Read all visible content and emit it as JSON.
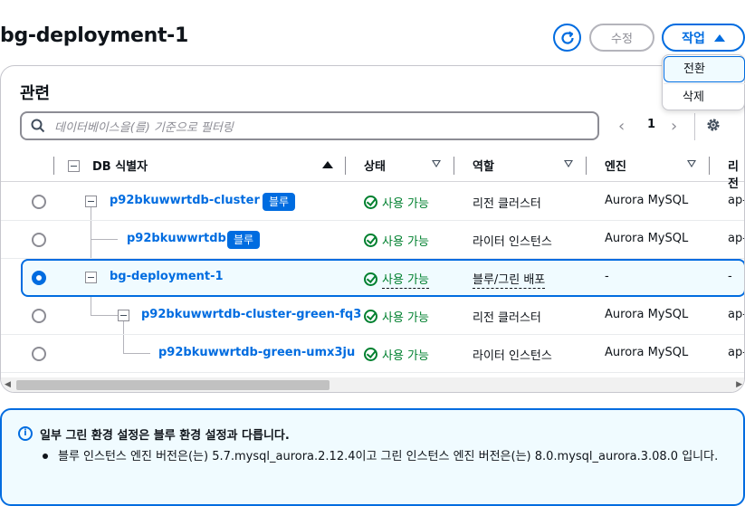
{
  "page": {
    "title": "bg-deployment-1"
  },
  "header_buttons": {
    "refresh_icon": "refresh-icon",
    "edit_label": "수정",
    "action_label": "작업"
  },
  "action_menu": {
    "items": [
      "전환",
      "삭제"
    ]
  },
  "related": {
    "title": "관련",
    "filter_placeholder": "데이터베이스을(를) 기준으로 필터링",
    "page_number": "1",
    "columns": [
      "DB 식별자",
      "상태",
      "역할",
      "엔진",
      "리전"
    ],
    "rows": [
      {
        "id": "p92bkuwwrtdb-cluster",
        "badge": "블루",
        "status": "사용 가능",
        "role": "리전 클러스터",
        "engine": "Aurora MySQL",
        "region": "ap-"
      },
      {
        "id": "p92bkuwwrtdb",
        "badge": "블루",
        "status": "사용 가능",
        "role": "라이터 인스턴스",
        "engine": "Aurora MySQL",
        "region": "ap-"
      },
      {
        "id": "bg-deployment-1",
        "badge": "",
        "status": "사용 가능",
        "role": "블루/그린 배포",
        "engine": "-",
        "region": "-"
      },
      {
        "id": "p92bkuwwrtdb-cluster-green-fq3",
        "badge": "",
        "status": "사용 가능",
        "role": "리전 클러스터",
        "engine": "Aurora MySQL",
        "region": "ap-"
      },
      {
        "id": "p92bkuwwrtdb-green-umx3ju",
        "badge": "",
        "status": "사용 가능",
        "role": "라이터 인스턴스",
        "engine": "Aurora MySQL",
        "region": "ap-"
      }
    ]
  },
  "alert": {
    "title": "일부 그린 환경 설정은 블루 환경 설정과 다릅니다.",
    "body": "블루 인스턴스 엔진 버전은(는) 5.7.mysql_aurora.2.12.4이고 그린 인스턴스 엔진 버전은(는) 8.0.mysql_aurora.3.08.0 입니다."
  },
  "colors": {
    "accent": "#006ce0",
    "success": "#00802f",
    "border": "#c6c6cd"
  }
}
